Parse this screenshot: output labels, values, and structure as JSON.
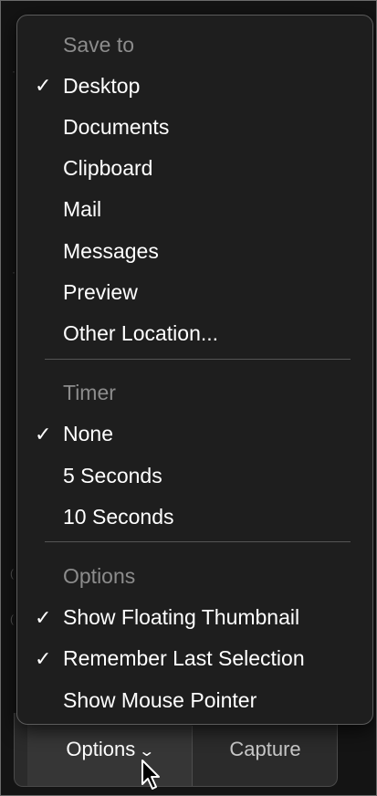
{
  "toolbar": {
    "options_label": "Options",
    "capture_label": "Capture"
  },
  "menu": {
    "sections": [
      {
        "header": "Save to",
        "items": [
          {
            "label": "Desktop",
            "checked": true
          },
          {
            "label": "Documents",
            "checked": false
          },
          {
            "label": "Clipboard",
            "checked": false
          },
          {
            "label": "Mail",
            "checked": false
          },
          {
            "label": "Messages",
            "checked": false
          },
          {
            "label": "Preview",
            "checked": false
          },
          {
            "label": "Other Location...",
            "checked": false
          }
        ]
      },
      {
        "header": "Timer",
        "items": [
          {
            "label": "None",
            "checked": true
          },
          {
            "label": "5 Seconds",
            "checked": false
          },
          {
            "label": "10 Seconds",
            "checked": false
          }
        ]
      },
      {
        "header": "Options",
        "items": [
          {
            "label": "Show Floating Thumbnail",
            "checked": true
          },
          {
            "label": "Remember Last Selection",
            "checked": true
          },
          {
            "label": "Show Mouse Pointer",
            "checked": false
          }
        ]
      }
    ],
    "check_glyph": "✓"
  }
}
